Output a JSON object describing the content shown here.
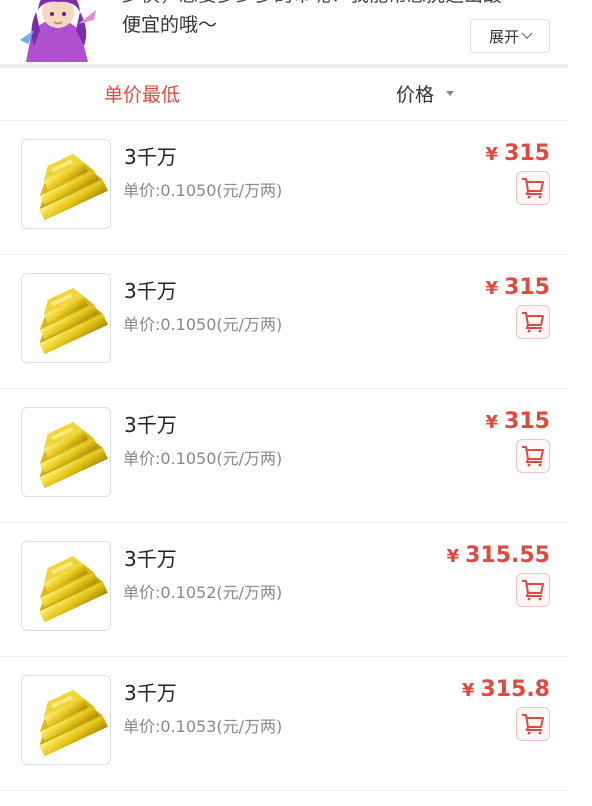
{
  "banner": {
    "text_line1": "少侠，您要多少多的币呢？我能帮您挑选出最",
    "text_line2": "便宜的哦～",
    "expand_label": "展开"
  },
  "sort": {
    "lowest_unit_price": "单价最低",
    "price": "价格"
  },
  "colors": {
    "accent": "#e0493f"
  },
  "items": [
    {
      "title": "3千万",
      "unit_price": "单价:0.1050(元/万两)",
      "currency": "¥",
      "price": "315",
      "icon": "gold-ingot-icon",
      "action_icon": "cart-icon"
    },
    {
      "title": "3千万",
      "unit_price": "单价:0.1050(元/万两)",
      "currency": "¥",
      "price": "315",
      "icon": "gold-ingot-icon",
      "action_icon": "cart-icon"
    },
    {
      "title": "3千万",
      "unit_price": "单价:0.1050(元/万两)",
      "currency": "¥",
      "price": "315",
      "icon": "gold-ingot-icon",
      "action_icon": "cart-icon"
    },
    {
      "title": "3千万",
      "unit_price": "单价:0.1052(元/万两)",
      "currency": "¥",
      "price": "315.55",
      "icon": "gold-ingot-icon",
      "action_icon": "cart-icon"
    },
    {
      "title": "3千万",
      "unit_price": "单价:0.1053(元/万两)",
      "currency": "¥",
      "price": "315.8",
      "icon": "gold-ingot-icon",
      "action_icon": "cart-icon"
    }
  ]
}
